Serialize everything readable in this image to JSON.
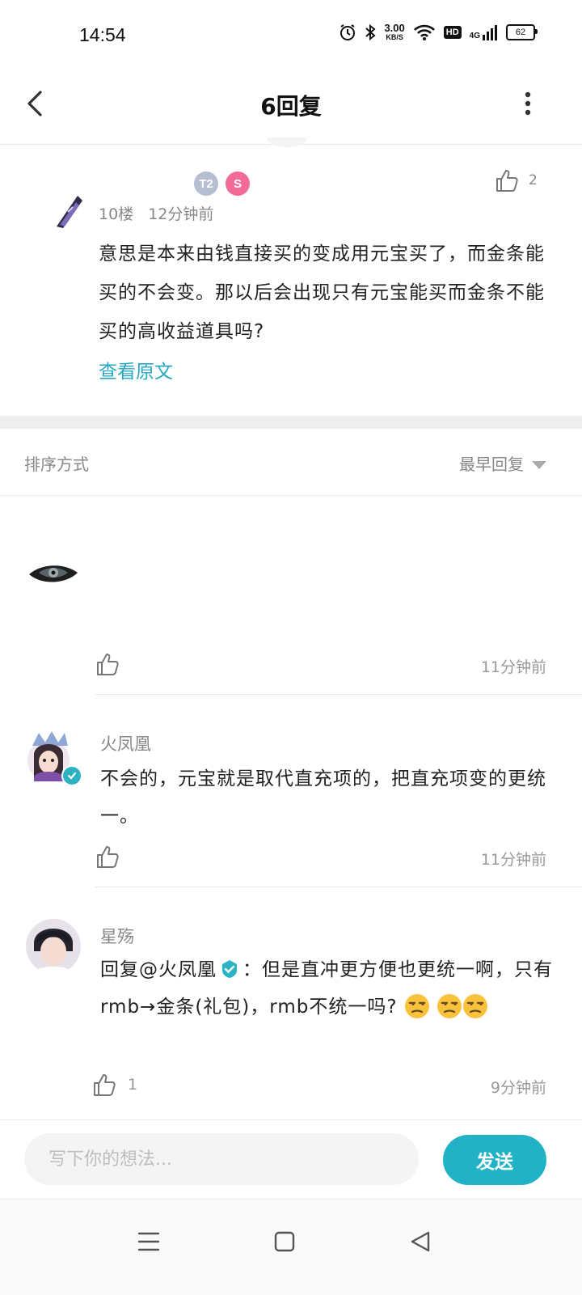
{
  "status_bar": {
    "time": "14:54",
    "net_speed_value": "3.00",
    "net_speed_unit": "KB/S",
    "hd_label": "HD",
    "network_label": "4G",
    "battery": "62"
  },
  "header": {
    "title": "6回复"
  },
  "main_comment": {
    "badge_t": "T2",
    "badge_s": "S",
    "likes": "2",
    "floor": "10楼",
    "time": "12分钟前",
    "text": "意思是本来由钱直接买的变成用元宝买了，而金条能买的不会变。那以后会出现只有元宝能买而金条不能买的高收益道具吗?",
    "view_original": "查看原文"
  },
  "sort": {
    "label": "排序方式",
    "selected": "最早回复"
  },
  "replies": [
    {
      "name": "",
      "text": "",
      "time": "11分钟前",
      "likes": ""
    },
    {
      "name": "火凤凰",
      "text": "不会的，元宝就是取代直充项的，把直充项变的更统一。",
      "time": "11分钟前",
      "likes": ""
    },
    {
      "name": "星殇",
      "reply_prefix": "回复",
      "mention": "@火凤凰",
      "text_after_mention": "：但是直冲更方便也更统一啊，只有rmb→金条(礼包)，rmb不统一吗?",
      "time": "9分钟前",
      "likes": "1"
    }
  ],
  "input": {
    "placeholder": "写下你的想法...",
    "send_label": "发送"
  },
  "colors": {
    "accent": "#21b2c5",
    "link": "#26a8c0",
    "muted_text": "#888888"
  },
  "icons": [
    "back-icon",
    "more-icon",
    "thumbs-up-icon",
    "verified-icon",
    "unamused-emoji-icon",
    "menu-icon",
    "home-icon",
    "back-triangle-icon"
  ]
}
